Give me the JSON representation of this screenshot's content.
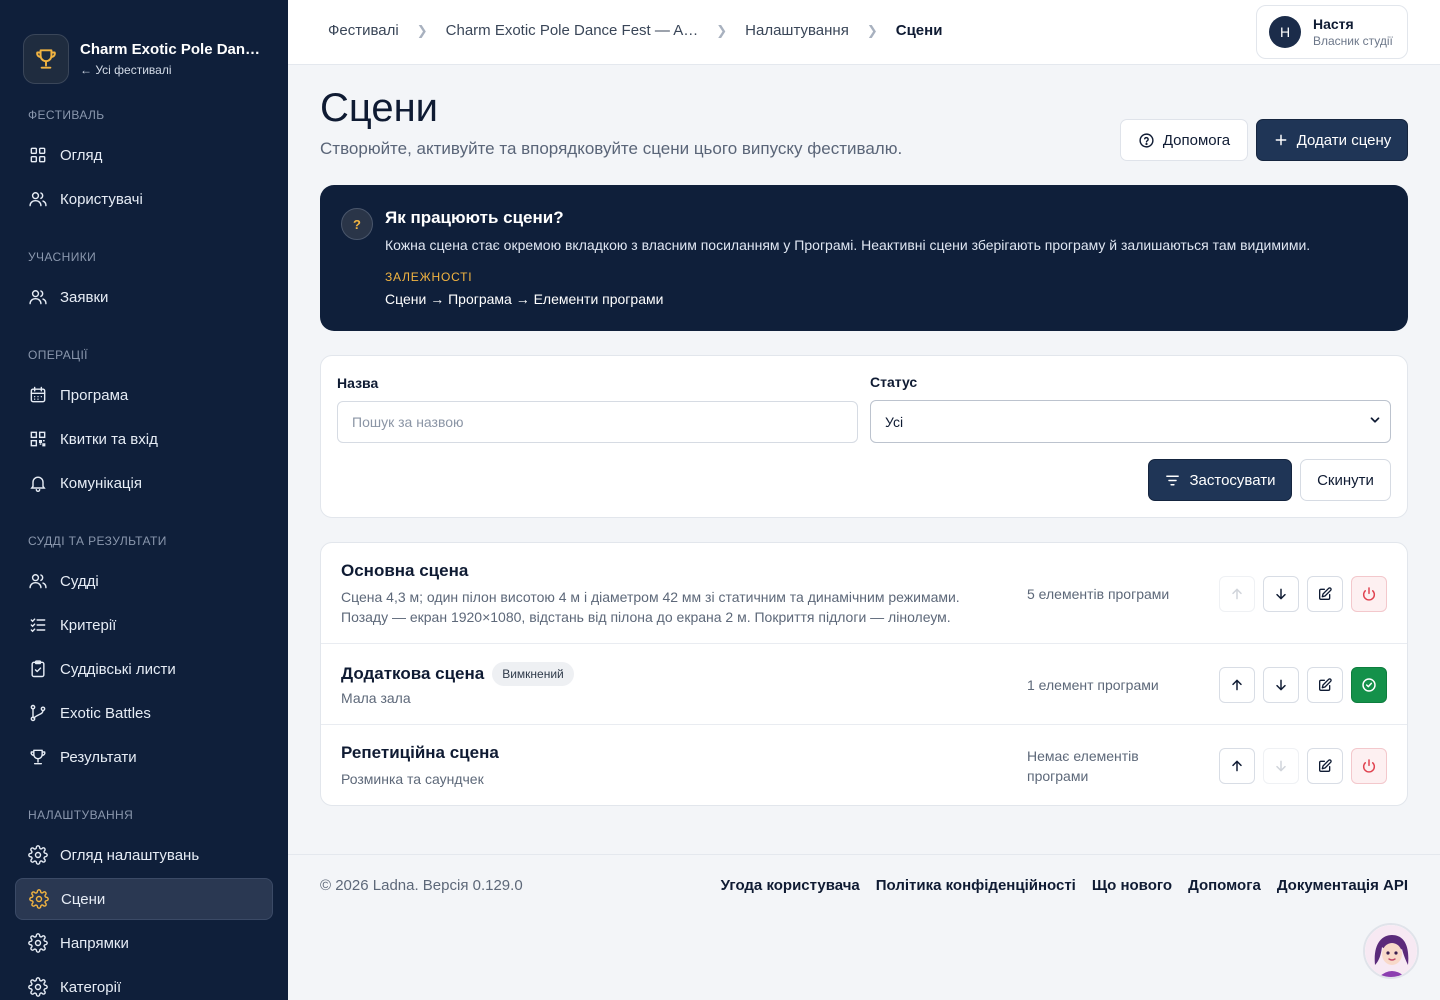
{
  "brand": {
    "title": "Charm Exotic Pole Dance Fest — A…",
    "back": "← Усі фестивалі"
  },
  "sidebar": {
    "sections": [
      {
        "title": "Фестиваль",
        "items": [
          {
            "label": "Огляд",
            "icon": "grid-icon"
          },
          {
            "label": "Користувачі",
            "icon": "users-icon"
          }
        ]
      },
      {
        "title": "Учасники",
        "items": [
          {
            "label": "Заявки",
            "icon": "users-icon"
          }
        ]
      },
      {
        "title": "Операції",
        "items": [
          {
            "label": "Програма",
            "icon": "calendar-icon"
          },
          {
            "label": "Квитки та вхід",
            "icon": "qr-icon"
          },
          {
            "label": "Комунікація",
            "icon": "bell-icon"
          }
        ]
      },
      {
        "title": "Судді та результати",
        "items": [
          {
            "label": "Судді",
            "icon": "users-icon"
          },
          {
            "label": "Критерії",
            "icon": "checklist-icon"
          },
          {
            "label": "Суддівські листи",
            "icon": "clipboard-check-icon"
          },
          {
            "label": "Exotic Battles",
            "icon": "branch-icon"
          },
          {
            "label": "Результати",
            "icon": "trophy-icon"
          }
        ]
      },
      {
        "title": "Налаштування",
        "items": [
          {
            "label": "Огляд налаштувань",
            "icon": "gear-icon"
          },
          {
            "label": "Сцени",
            "icon": "gear-icon",
            "active": true
          },
          {
            "label": "Напрямки",
            "icon": "gear-icon"
          },
          {
            "label": "Категорії",
            "icon": "gear-icon"
          }
        ]
      }
    ]
  },
  "breadcrumb": [
    "Фестивалі",
    "Charm Exotic Pole Dance Fest — A…",
    "Налаштування",
    "Сцени"
  ],
  "user": {
    "initial": "Н",
    "name": "Настя",
    "role": "Власник студії"
  },
  "page": {
    "title": "Сцени",
    "subtitle": "Створюйте, активуйте та впорядковуйте сцени цього випуску фестивалю.",
    "help_label": "Допомога",
    "add_label": "Додати сцену"
  },
  "info": {
    "mark": "?",
    "title": "Як працюють сцени?",
    "text": "Кожна сцена стає окремою вкладкою з власним посиланням у Програмі. Неактивні сцени зберігають програму й залишаються там видимими.",
    "dep_label": "ЗАЛЕЖНОСТІ",
    "chain": "Сцени → Програма → Елементи програми"
  },
  "filters": {
    "name_label": "Назва",
    "name_placeholder": "Пошук за назвою",
    "name_value": "",
    "status_label": "Статус",
    "status_value": "Усі",
    "apply_label": "Застосувати",
    "reset_label": "Скинути"
  },
  "stages": [
    {
      "title": "Основна сцена",
      "badge": "",
      "desc": "Сцена 4,3 м; один пілон висотою 4 м і діаметром 42 мм зі статичним та динамічним режимами. Позаду — екран 1920×1080, відстань від пілона до екрана 2 м. Покриття підлоги — лінолеум.",
      "count": "5 елементів програми",
      "up_disabled": true,
      "down_disabled": false,
      "active": true
    },
    {
      "title": "Додаткова сцена",
      "badge": "Вимкнений",
      "desc": "Мала зала",
      "count": "1 елемент програми",
      "up_disabled": false,
      "down_disabled": false,
      "active": false
    },
    {
      "title": "Репетиційна сцена",
      "badge": "",
      "desc": "Розминка та саундчек",
      "count": "Немає елементів програми",
      "up_disabled": false,
      "down_disabled": true,
      "active": true
    }
  ],
  "footer": {
    "copyright": "© 2026 Ladna. Версія 0.129.0",
    "links": [
      "Угода користувача",
      "Політика конфіденційності",
      "Що нового",
      "Допомога",
      "Документація API"
    ]
  },
  "colors": {
    "sidebar_bg": "#0f1f3a",
    "primary": "#1f3556",
    "accent": "#f2b441",
    "success": "#14914a",
    "danger": "#e0424f"
  }
}
